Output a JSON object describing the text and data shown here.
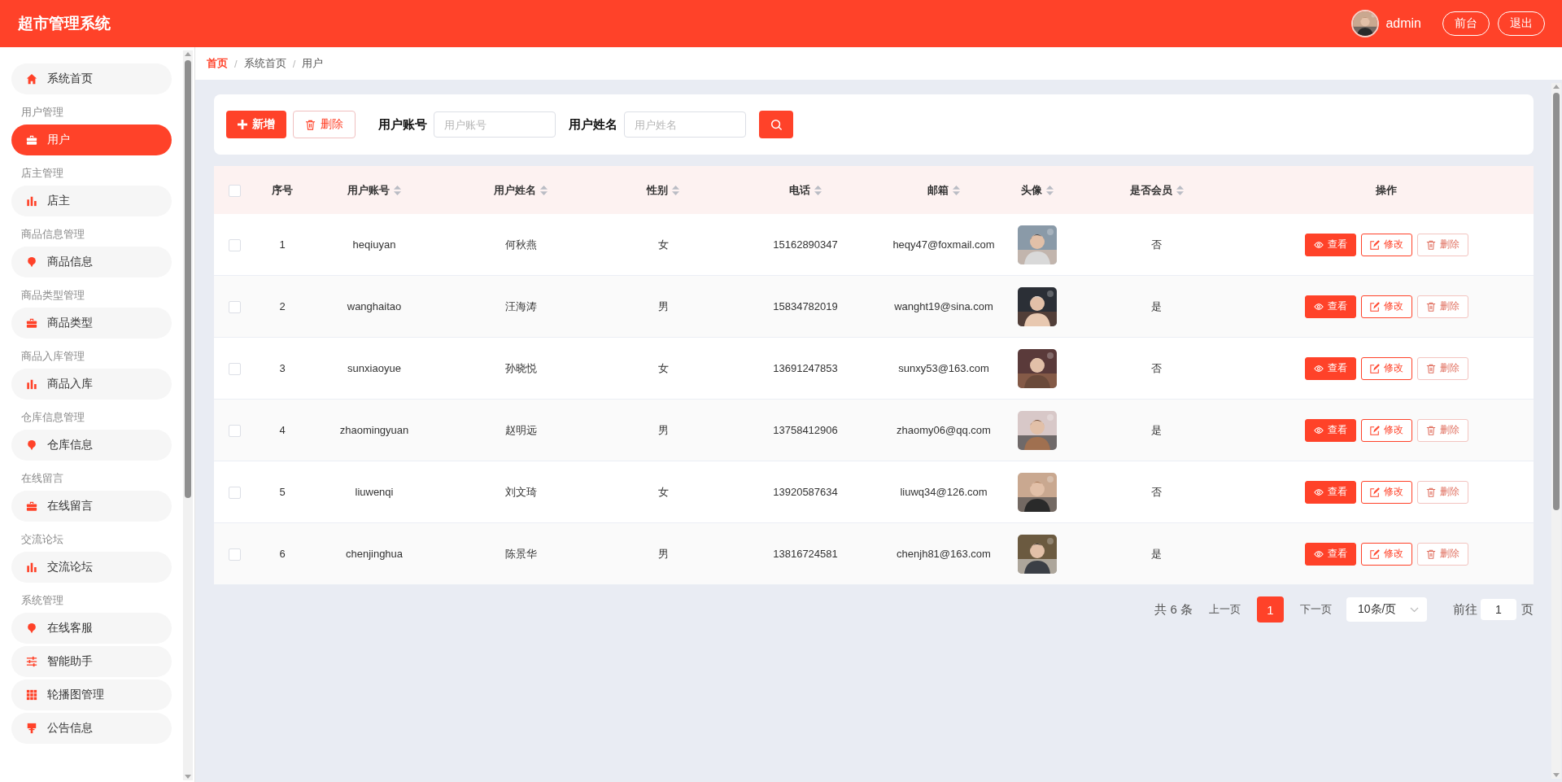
{
  "header": {
    "title": "超市管理系统",
    "user": "admin",
    "buttons": [
      "前台",
      "退出"
    ]
  },
  "sidebar": {
    "sections": [
      {
        "items": [
          {
            "label": "系统首页",
            "kind": "home",
            "selected": false
          }
        ]
      },
      {
        "heading": "用户管理",
        "items": [
          {
            "label": "用户",
            "kind": "case",
            "selected": true
          }
        ]
      },
      {
        "heading": "店主管理",
        "items": [
          {
            "label": "店主",
            "kind": "bars",
            "selected": false
          }
        ]
      },
      {
        "heading": "商品信息管理",
        "items": [
          {
            "label": "商品信息",
            "kind": "pin",
            "selected": false
          }
        ]
      },
      {
        "heading": "商品类型管理",
        "items": [
          {
            "label": "商品类型",
            "kind": "case",
            "selected": false
          }
        ]
      },
      {
        "heading": "商品入库管理",
        "items": [
          {
            "label": "商品入库",
            "kind": "bars",
            "selected": false
          }
        ]
      },
      {
        "heading": "仓库信息管理",
        "items": [
          {
            "label": "仓库信息",
            "kind": "pin",
            "selected": false
          }
        ]
      },
      {
        "heading": "在线留言",
        "items": [
          {
            "label": "在线留言",
            "kind": "case",
            "selected": false
          }
        ]
      },
      {
        "heading": "交流论坛",
        "items": [
          {
            "label": "交流论坛",
            "kind": "bars",
            "selected": false
          }
        ]
      },
      {
        "heading": "系统管理",
        "items": [
          {
            "label": "在线客服",
            "kind": "pin",
            "selected": false
          },
          {
            "label": "智能助手",
            "kind": "sliders",
            "selected": false
          },
          {
            "label": "轮播图管理",
            "kind": "grid",
            "selected": false
          },
          {
            "label": "公告信息",
            "kind": "sign",
            "selected": false
          }
        ]
      }
    ]
  },
  "breadcrumb": [
    {
      "kind": "link",
      "text": "首页"
    },
    {
      "kind": "separator",
      "text": "/"
    },
    {
      "kind": "link",
      "text": "系统首页"
    },
    {
      "kind": "separator",
      "text": "/"
    },
    {
      "kind": "link",
      "text": "用户"
    }
  ],
  "toolbar": {
    "buttons": [
      {
        "label": "新增",
        "kind": "add"
      },
      {
        "label": "删除",
        "kind": "delete"
      }
    ],
    "fields": [
      {
        "label": "用户账号",
        "placeholder": "用户账号"
      },
      {
        "label": "用户姓名",
        "placeholder": "用户姓名"
      }
    ]
  },
  "table": {
    "all_checked": false,
    "columns": [
      {
        "label": "序号",
        "sortable": false
      },
      {
        "label": "用户账号",
        "sortable": true
      },
      {
        "label": "用户姓名",
        "sortable": true
      },
      {
        "label": "性别",
        "sortable": true
      },
      {
        "label": "电话",
        "sortable": true
      },
      {
        "label": "邮箱",
        "sortable": true
      },
      {
        "label": "头像",
        "sortable": true
      },
      {
        "label": "是否会员",
        "sortable": true
      },
      {
        "label": "操作",
        "sortable": false
      }
    ],
    "rows": [
      {
        "checked": false,
        "cells": [
          "1",
          "heqiuyan",
          "何秋燕",
          "女",
          "15162890347",
          "heqy47@foxmail.com"
        ],
        "avatar": {
          "kind": "picture"
        },
        "member": "否",
        "actions": [
          {
            "label": "查看",
            "kind": "view"
          },
          {
            "label": "修改",
            "kind": "edit"
          },
          {
            "label": "删除",
            "kind": "delete"
          }
        ]
      },
      {
        "checked": false,
        "cells": [
          "2",
          "wanghaitao",
          "汪海涛",
          "男",
          "15834782019",
          "wanght19@sina.com"
        ],
        "avatar": {
          "kind": "picture"
        },
        "member": "是",
        "actions": [
          {
            "label": "查看",
            "kind": "view"
          },
          {
            "label": "修改",
            "kind": "edit"
          },
          {
            "label": "删除",
            "kind": "delete"
          }
        ]
      },
      {
        "checked": false,
        "cells": [
          "3",
          "sunxiaoyue",
          "孙晓悦",
          "女",
          "13691247853",
          "sunxy53@163.com"
        ],
        "avatar": {
          "kind": "picture"
        },
        "member": "否",
        "actions": [
          {
            "label": "查看",
            "kind": "view"
          },
          {
            "label": "修改",
            "kind": "edit"
          },
          {
            "label": "删除",
            "kind": "delete"
          }
        ]
      },
      {
        "checked": false,
        "cells": [
          "4",
          "zhaomingyuan",
          "赵明远",
          "男",
          "13758412906",
          "zhaomy06@qq.com"
        ],
        "avatar": {
          "kind": "picture"
        },
        "member": "是",
        "actions": [
          {
            "label": "查看",
            "kind": "view"
          },
          {
            "label": "修改",
            "kind": "edit"
          },
          {
            "label": "删除",
            "kind": "delete"
          }
        ]
      },
      {
        "checked": false,
        "cells": [
          "5",
          "liuwenqi",
          "刘文琦",
          "女",
          "13920587634",
          "liuwq34@126.com"
        ],
        "avatar": {
          "kind": "picture"
        },
        "member": "否",
        "actions": [
          {
            "label": "查看",
            "kind": "view"
          },
          {
            "label": "修改",
            "kind": "edit"
          },
          {
            "label": "删除",
            "kind": "delete"
          }
        ]
      },
      {
        "checked": false,
        "cells": [
          "6",
          "chenjinghua",
          "陈景华",
          "男",
          "13816724581",
          "chenjh81@163.com"
        ],
        "avatar": {
          "kind": "picture"
        },
        "member": "是",
        "actions": [
          {
            "label": "查看",
            "kind": "view"
          },
          {
            "label": "修改",
            "kind": "edit"
          },
          {
            "label": "删除",
            "kind": "delete"
          }
        ]
      }
    ]
  },
  "pagination": {
    "total": "共 6 条",
    "prev": "上一页",
    "pages": [
      {
        "label": "1",
        "selected": true
      }
    ],
    "next": "下一页",
    "page_size": "10条/页",
    "goto_label": "前往",
    "goto_value": "1",
    "goto_suffix": "页"
  }
}
